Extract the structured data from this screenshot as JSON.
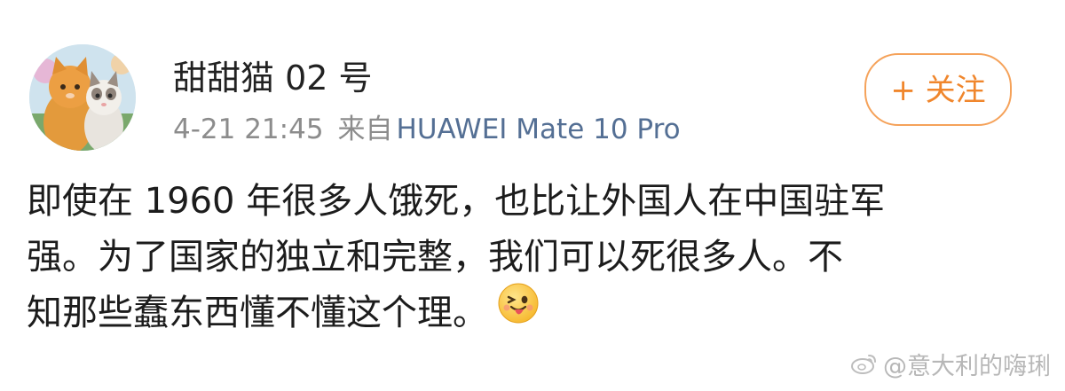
{
  "post": {
    "username": "甜甜猫 02 号",
    "timestamp": "4-21 21:45",
    "source_prefix": "来自",
    "device": "HUAWEI Mate 10 Pro",
    "follow_label": "+ 关注",
    "body_lines": [
      "即使在 1960 年很多人饿死，也比让外国人在中国驻军",
      "强。为了国家的独立和完整，我们可以死很多人。不",
      "知那些蠢东西懂不懂这个理。"
    ],
    "emoji": "tongue-wink-emoji"
  },
  "watermark": {
    "text": "@意大利的嗨琍",
    "icon": "weibo-logo-icon"
  },
  "colors": {
    "follow_accent": "#f0862c",
    "device_link": "#546f94",
    "meta_gray": "#8c8c8c",
    "text": "#1c1c1c"
  }
}
